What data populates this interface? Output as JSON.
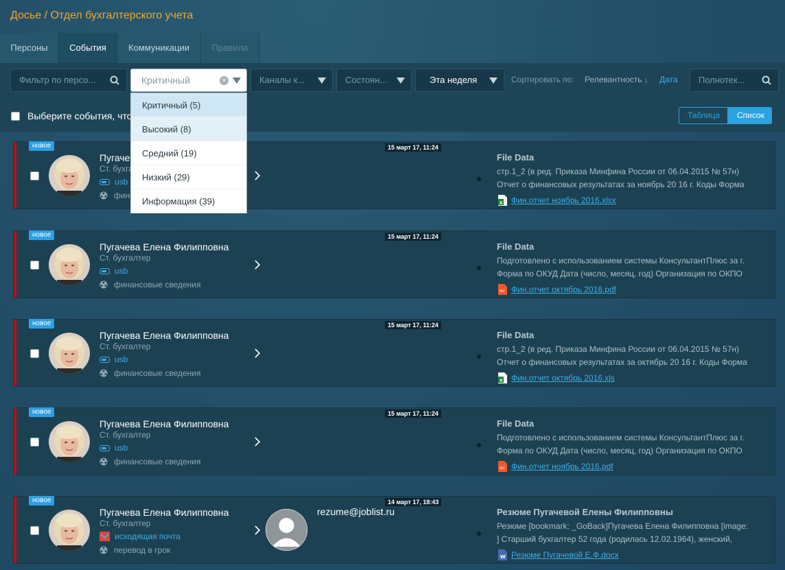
{
  "breadcrumb": "Досье / Отдел бухгалтерского учета",
  "tabs": [
    {
      "label": "Персоны",
      "state": "normal"
    },
    {
      "label": "События",
      "state": "active"
    },
    {
      "label": "Коммуникации",
      "state": "normal"
    },
    {
      "label": "Правила",
      "state": "disabled"
    }
  ],
  "filters": {
    "person_placeholder": "Фильтр по персо...",
    "criticality_value": "Критичный",
    "channels_placeholder": "Каналы к...",
    "state_placeholder": "Состоян...",
    "period_value": "Эта неделя",
    "fulltext_placeholder": "Полнотек..."
  },
  "sort": {
    "label": "Сортировать по:",
    "relevance": "Релевантность ↓",
    "date": "Дата"
  },
  "select_all_label": "Выберите события, что",
  "view_toggle": {
    "table": "Таблица",
    "list": "Список",
    "active": "list"
  },
  "criticality_dropdown": [
    "Критичный (5)",
    "Высокий (8)",
    "Средний (19)",
    "Низкий (29)",
    "Информация (39)"
  ],
  "colors": {
    "accent": "#2aa3e0",
    "critical_edge": "#b5121b",
    "breadcrumb": "#f0a830"
  },
  "events": [
    {
      "badge": "новое",
      "name": "Пугачева Елена Филипповна",
      "role": "Ст. бухгалтер",
      "channel_icon": "usb-icon",
      "channel": "usb",
      "policy": "финансовые сведения",
      "time": "15 март 17, 11:24",
      "title": "File Data",
      "line1": "стр.1_2 (в ред. Приказа Минфина России от 06.04.2015 № 57н)",
      "line2": "Отчет о финансовых результатах за ноябрь 20 16 г. Коды Форма",
      "file_icon": "xlsx-file-icon",
      "file_name": "Фин.отчет ноябрь 2016.xlsx"
    },
    {
      "badge": "новое",
      "name": "Пугачева Елена Филипповна",
      "role": "Ст. бухгалтер",
      "channel_icon": "usb-icon",
      "channel": "usb",
      "policy": "финансовые сведения",
      "time": "15 март 17, 11:24",
      "title": "File Data",
      "line1": "Подготовлено с использованием системы КонсультантПлюс за г.",
      "line2": "Форма по ОКУД Дата (число, месяц, год) Организация по ОКПО",
      "file_icon": "pdf-file-icon",
      "file_name": "Фин.отчет октябрь 2016.pdf"
    },
    {
      "badge": "новое",
      "name": "Пугачева Елена Филипповна",
      "role": "Ст. бухгалтер",
      "channel_icon": "usb-icon",
      "channel": "usb",
      "policy": "финансовые сведения",
      "time": "15 март 17, 11:24",
      "title": "File Data",
      "line1": "стр.1_2 (в ред. Приказа Минфина России от 06.04.2015 № 57н)",
      "line2": "Отчет о финансовых результатах за октябрь 20 16 г. Коды Форма",
      "file_icon": "xls-file-icon",
      "file_name": "Фин.отчет октябрь 2016.xls"
    },
    {
      "badge": "новое",
      "name": "Пугачева Елена Филипповна",
      "role": "Ст. бухгалтер",
      "channel_icon": "usb-icon",
      "channel": "usb",
      "policy": "финансовые сведения",
      "time": "15 март 17, 11:24",
      "title": "File Data",
      "line1": "Подготовлено с использованием системы КонсультантПлюс за г.",
      "line2": "Форма по ОКУД Дата (число, месяц, год) Организация по ОКПО",
      "file_icon": "pdf-file-icon",
      "file_name": "Фин.отчет ноябрь 2016.pdf"
    },
    {
      "badge": "новое",
      "name": "Пугачева Елена Филипповна",
      "role": "Ст. бухгалтер",
      "channel_icon": "outgoing-mail-icon",
      "channel": "исходящая почта",
      "policy": "перевод в грок",
      "time": "14 март 17, 18:43",
      "recipient": "rezume@joblist.ru",
      "title": "Резюме Пугачевой Елены Филипповны",
      "line1": "Резюме [bookmark: _GoBack]Пугачева Елена Филипповна [image:",
      "line2": "] Старший бухгалтер 52 года (родилась 12.02.1964), женский,",
      "file_icon": "docx-file-icon",
      "file_name": "Резюме Пугачевой Е.Ф.docx"
    }
  ]
}
